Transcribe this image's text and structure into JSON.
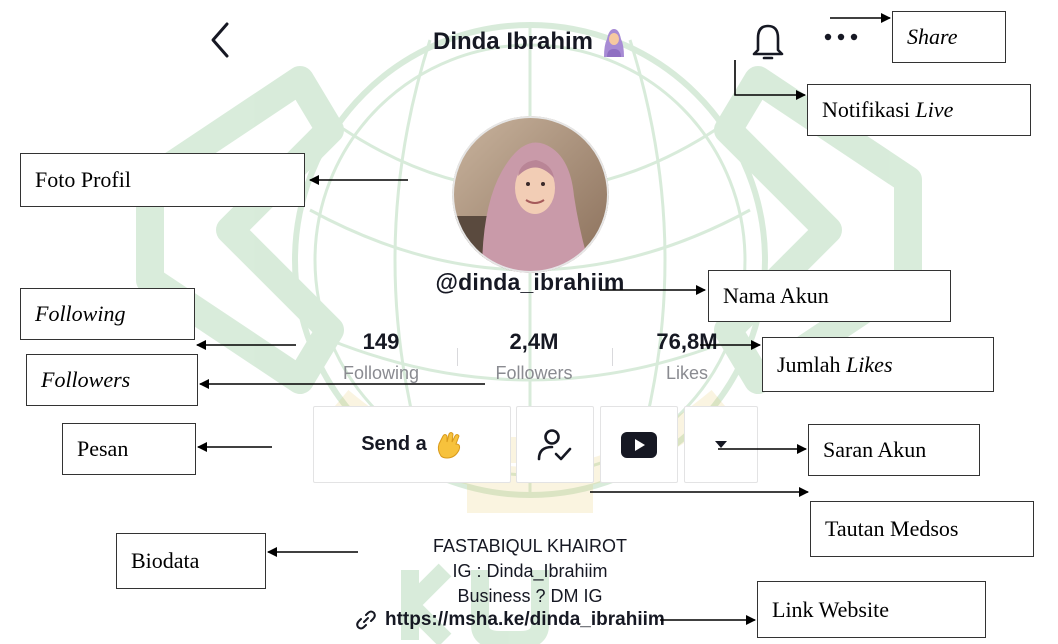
{
  "header": {
    "title": "Dinda Ibrahim",
    "emoji_icon": "woman-with-headscarf-emoji"
  },
  "profile": {
    "username": "@dinda_ibrahiim",
    "avatar_icon": "profile-photo"
  },
  "stats": [
    {
      "value": "149",
      "label": "Following"
    },
    {
      "value": "2,4M",
      "label": "Followers"
    },
    {
      "value": "76,8M",
      "label": "Likes"
    }
  ],
  "actions": {
    "send_label": "Send a",
    "send_emoji": "waving-hand-emoji"
  },
  "bio": {
    "lines": [
      "FASTABIQUL KHAIROT",
      "IG : Dinda_Ibrahiim",
      "Business ? DM IG"
    ],
    "link": "https://msha.ke/dinda_ibrahiim"
  },
  "annotations": {
    "share": "Share",
    "notif_prefix": "Notifikasi ",
    "notif_live": "Live",
    "foto_profil": "Foto Profil",
    "nama_akun": "Nama Akun",
    "following": "Following",
    "followers": "Followers",
    "jumlah_prefix": "Jumlah ",
    "jumlah_likes": "Likes",
    "pesan": "Pesan",
    "saran_akun": "Saran Akun",
    "tautan_medsos": "Tautan Medsos",
    "biodata": "Biodata",
    "link_website": "Link Website"
  },
  "colors": {
    "watermark_green": "#3f9e4a",
    "watermark_gold": "#e7c96a",
    "text_primary": "#161823",
    "text_secondary": "#8a8b91"
  }
}
